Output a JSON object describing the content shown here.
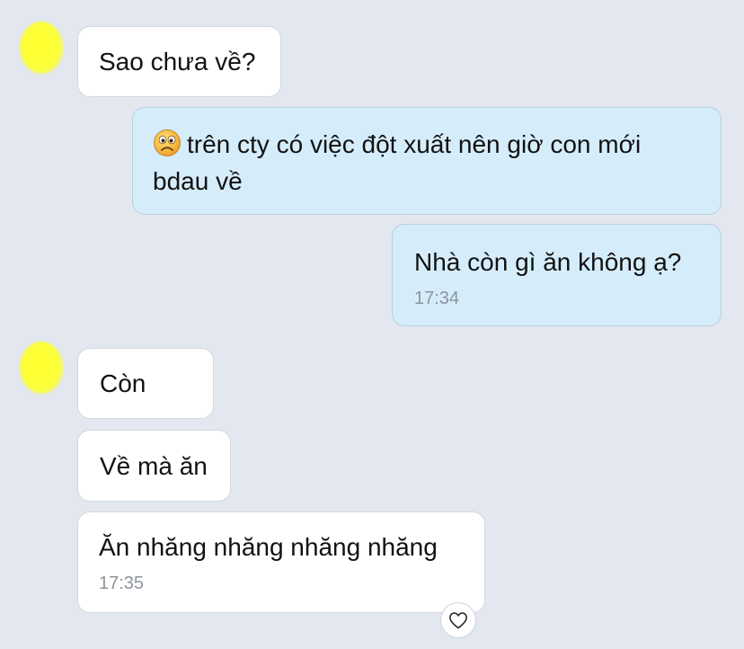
{
  "conversation": {
    "messages": [
      {
        "direction": "incoming",
        "lines": [
          "Sao chưa về?"
        ]
      },
      {
        "direction": "outgoing",
        "emoji": "crying-face-emoji",
        "lines": [
          "trên cty có việc đột xuất nên giờ con mới",
          "bdau về"
        ]
      },
      {
        "direction": "outgoing",
        "lines": [
          "Nhà còn gì ăn không ạ?"
        ],
        "time": "17:34"
      },
      {
        "direction": "incoming",
        "lines": [
          "Còn"
        ]
      },
      {
        "direction": "incoming",
        "lines": [
          "Về mà ăn"
        ]
      },
      {
        "direction": "incoming",
        "lines": [
          "Ăn nhăng nhăng nhăng nhăng"
        ],
        "time": "17:35"
      }
    ],
    "reaction_icon": "heart-icon"
  },
  "colors": {
    "background": "#e3e7ef",
    "incoming_bubble": "#ffffff",
    "outgoing_bubble": "#d5edfb",
    "timestamp": "#8e949b",
    "avatar_blur": "#fbff3a"
  }
}
